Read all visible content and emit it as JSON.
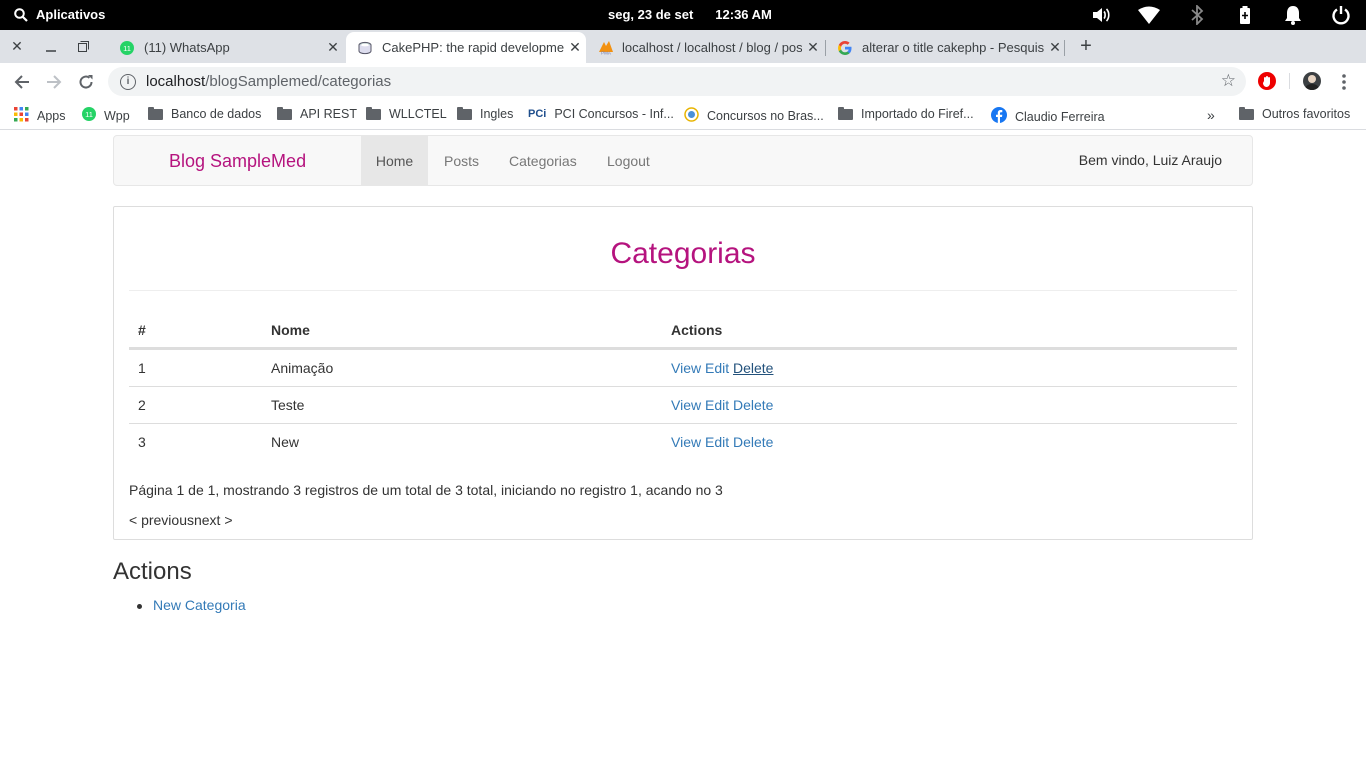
{
  "os": {
    "apps_label": "Aplicativos",
    "date": "seg, 23 de set",
    "time": "12:36 AM"
  },
  "tabs": [
    {
      "title": "(11) WhatsApp",
      "icon": "whatsapp-icon",
      "badge": "11",
      "active": false
    },
    {
      "title": "CakePHP: the rapid development php framework",
      "icon": "cakephp-icon",
      "active": true
    },
    {
      "title": "localhost / localhost / blog / posts",
      "icon": "phpmyadmin-icon",
      "active": false
    },
    {
      "title": "alterar o title cakephp - Pesquisa Google",
      "icon": "google-icon",
      "active": false
    }
  ],
  "address": {
    "host": "localhost",
    "path": "/blogSamplemed/categorias"
  },
  "bookmarks": [
    {
      "label": "Apps",
      "icon": "apps-grid-icon"
    },
    {
      "label": "Wpp",
      "icon": "whatsapp-icon"
    },
    {
      "label": "Banco de dados",
      "icon": "folder-icon"
    },
    {
      "label": "API REST",
      "icon": "folder-icon"
    },
    {
      "label": "WLLCTEL",
      "icon": "folder-icon"
    },
    {
      "label": "Ingles",
      "icon": "folder-icon"
    },
    {
      "label": "PCI Concursos - Inf...",
      "icon": "pci-icon",
      "icon_text": "PCi"
    },
    {
      "label": "Concursos no Bras...",
      "icon": "concursos-icon"
    },
    {
      "label": "Importado do Firef...",
      "icon": "folder-icon"
    },
    {
      "label": "Claudio Ferreira",
      "icon": "facebook-icon"
    }
  ],
  "bookmarks_other": "Outros favoritos",
  "site": {
    "brand": "Blog SampleMed",
    "nav": [
      "Home",
      "Posts",
      "Categorias",
      "Logout"
    ],
    "welcome": "Bem vindo, Luiz Araujo"
  },
  "panel": {
    "title": "Categorias",
    "headers": [
      "#",
      "Nome",
      "Actions"
    ],
    "rows": [
      {
        "id": "1",
        "name": "Animação"
      },
      {
        "id": "2",
        "name": "Teste"
      },
      {
        "id": "3",
        "name": "New"
      }
    ],
    "row_actions": [
      "View",
      "Edit",
      "Delete"
    ],
    "paging_info": "Página 1 de 1, mostrando 3 registros de um total de 3 total, iniciando no registro 1, acando no 3",
    "prev": "< previous",
    "next": "next >"
  },
  "actions": {
    "title": "Actions",
    "items": [
      "New Categoria"
    ]
  },
  "colors": {
    "brand": "#b5137e",
    "link": "#337ab7"
  }
}
